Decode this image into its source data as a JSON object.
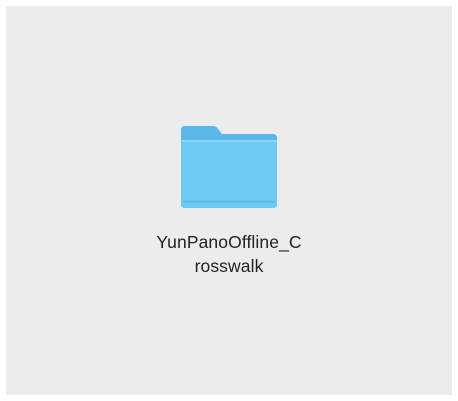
{
  "folder": {
    "name_line1": "YunPanoOffline_C",
    "name_line2": "rosswalk",
    "icon": "folder-icon"
  },
  "colors": {
    "background": "#ececec",
    "folder_front": "#6ec9f5",
    "folder_back": "#5bb8ea",
    "folder_tab": "#66c0ef",
    "folder_base_line": "#4fa9dd"
  }
}
